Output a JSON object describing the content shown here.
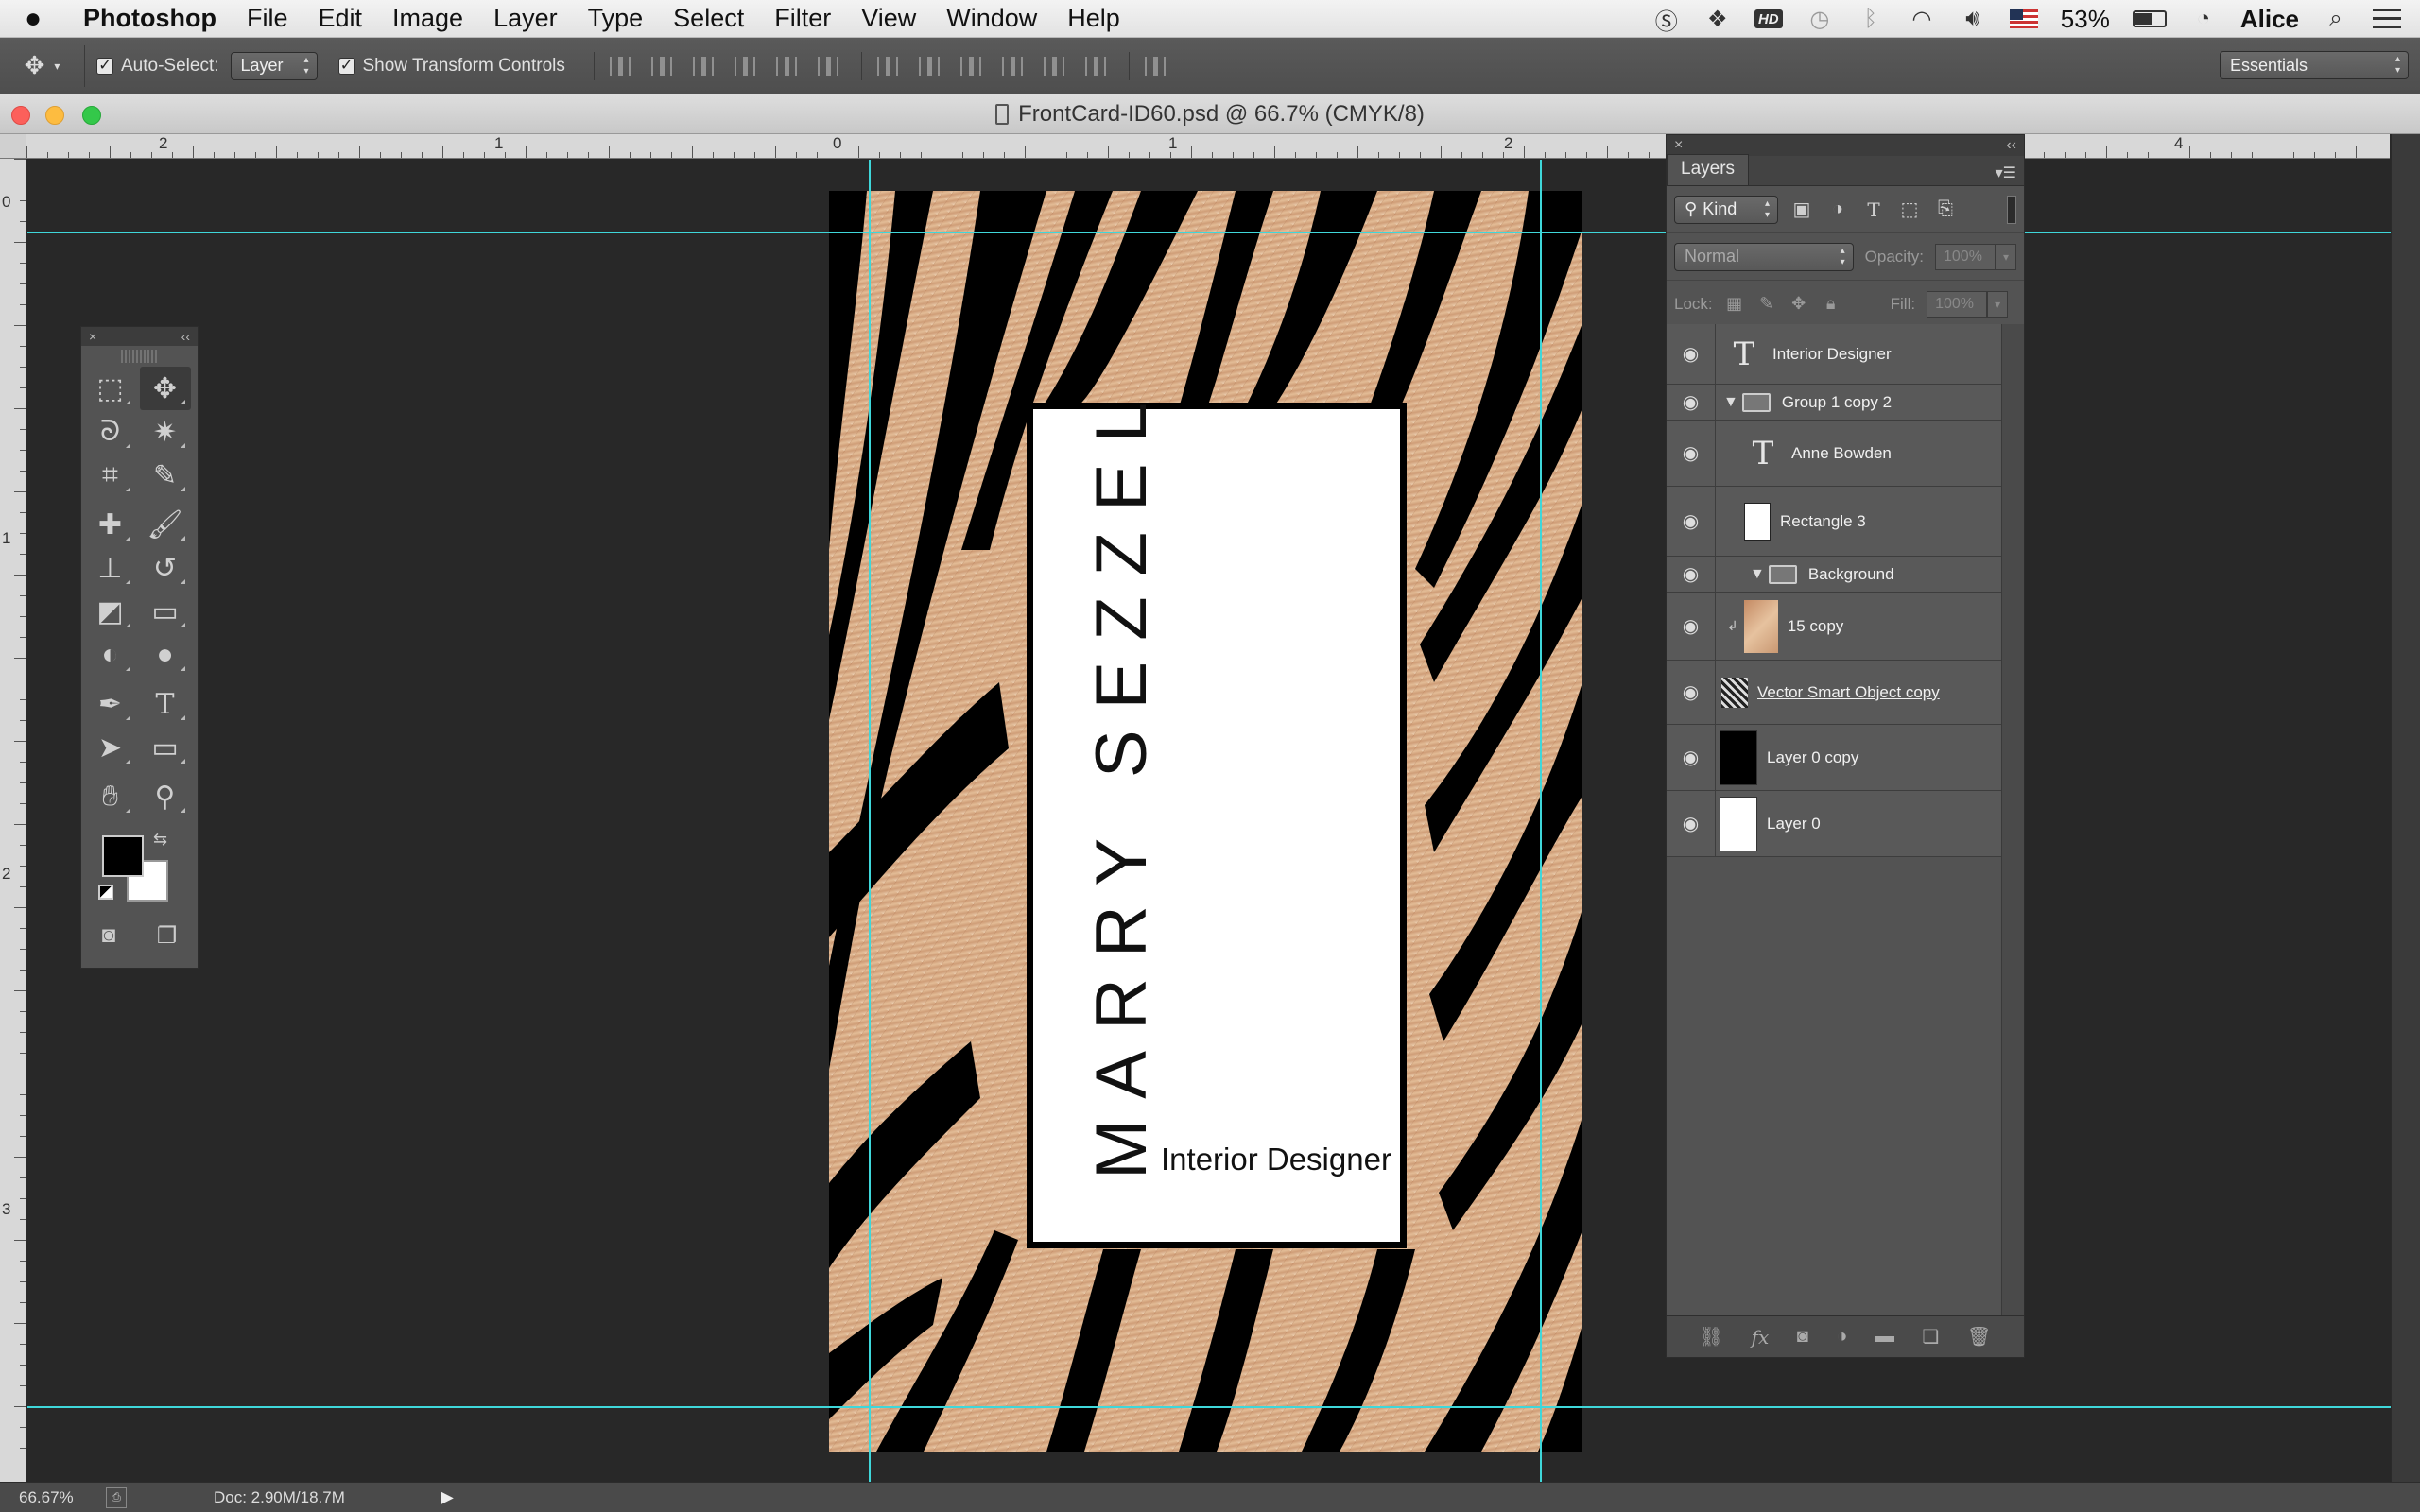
{
  "menubar": {
    "app_name": "Photoshop",
    "menus": [
      "File",
      "Edit",
      "Image",
      "Layer",
      "Type",
      "Select",
      "Filter",
      "View",
      "Window",
      "Help"
    ],
    "battery_percent": "53%",
    "battery_level": 0.53,
    "user": "Alice",
    "tray_icons": [
      "skype-icon",
      "dropbox-icon",
      "hd-icon",
      "time-machine-icon",
      "bluetooth-icon",
      "wifi-icon",
      "volume-icon",
      "flag-icon"
    ],
    "hd_label": "HD"
  },
  "options": {
    "auto_select_label": "Auto-Select:",
    "auto_select_value": "Layer",
    "transform_label": "Show Transform Controls",
    "workspace": "Essentials"
  },
  "document": {
    "title": "FrontCard-ID60.psd @ 66.7% (CMYK/8)"
  },
  "rulers": {
    "top_labels": [
      "2",
      "1",
      "0",
      "1",
      "2",
      "4"
    ],
    "left_labels": [
      "0",
      "1",
      "2",
      "3"
    ]
  },
  "card": {
    "name": "MARRY SEZZEL",
    "title": "Interior Designer"
  },
  "tools_panel": {
    "close": "×",
    "collapse": "‹‹"
  },
  "layers_panel": {
    "tab": "Layers",
    "close": "×",
    "collapse": "‹‹",
    "filter_kind": "Kind",
    "blend_mode": "Normal",
    "opacity_label": "Opacity:",
    "opacity_value": "100%",
    "lock_label": "Lock:",
    "fill_label": "Fill:",
    "fill_value": "100%",
    "layers": [
      {
        "name": "Interior Designer",
        "kind": "text"
      },
      {
        "name": "Group 1 copy 2",
        "kind": "group"
      },
      {
        "name": "Anne Bowden",
        "kind": "text"
      },
      {
        "name": "Rectangle 3",
        "kind": "shape"
      },
      {
        "name": "Background",
        "kind": "group"
      },
      {
        "name": "15 copy",
        "kind": "image"
      },
      {
        "name": "Vector Smart Object copy",
        "kind": "smart"
      },
      {
        "name": "Layer 0 copy",
        "kind": "black"
      },
      {
        "name": "Layer 0",
        "kind": "white"
      }
    ]
  },
  "status": {
    "zoom": "66.67%",
    "doc_size": "Doc: 2.90M/18.7M"
  },
  "colors": {
    "guide": "#3fd7da",
    "gold": "#d4a77f",
    "foreground": "#000000",
    "background": "#ffffff"
  }
}
